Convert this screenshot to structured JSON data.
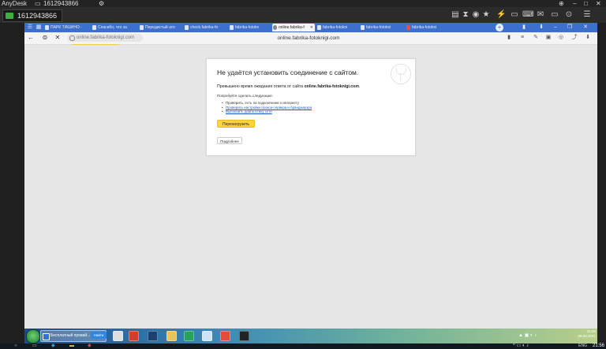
{
  "anydesk": {
    "app_name": "AnyDesk",
    "session_id_title": "1612943866",
    "session_id": "1612943866"
  },
  "browser": {
    "tabs": [
      {
        "label": "ПАРК ТИШИНО ·"
      },
      {
        "label": "Спасибо, что за"
      },
      {
        "label": "Передистый ато"
      },
      {
        "label": "check.fabrika-fo"
      },
      {
        "label": "fabrika-fotokn"
      },
      {
        "label": "online.fabrika-f",
        "active": true
      },
      {
        "label": "fabrika-fotokni"
      },
      {
        "label": "fabrika-fotokni"
      },
      {
        "label": "fabrika-fotokni"
      }
    ],
    "address_pill": "online.fabrika-fotoknigi.com",
    "address_center": "online.fabrika-fotoknigi.com"
  },
  "error_page": {
    "title": "Не удаётся установить соединение с сайтом.",
    "desc_prefix": "Превышено время ожидания ответа от сайта ",
    "desc_host": "online.fabrika-fotoknigi.com",
    "desc_suffix": ".",
    "try_label": "Попробуйте сделать следующее:",
    "suggestions": [
      {
        "text": "Проверить, есть ли подключение к интернету",
        "link": false
      },
      {
        "text": "Проверить настройки прокси-сервера и брандмауэра",
        "link": true
      },
      {
        "text": "Выполнить диагностику сети",
        "link": true
      }
    ],
    "reload_label": "Перезагрузить",
    "details_label": "Подробнее"
  },
  "remote_taskbar": {
    "task1_label": "Бесплатный провай...",
    "task2_label": "Найти",
    "time": "21:56",
    "date": "08.05.2021"
  },
  "local_taskbar": {
    "lang": "ENG",
    "time": "21:56"
  },
  "colors": {
    "tab_strip": "#3d6fcc",
    "reload_button": "#ffd43a",
    "link": "#1a57c8",
    "anydesk_green": "#3fae3f"
  }
}
